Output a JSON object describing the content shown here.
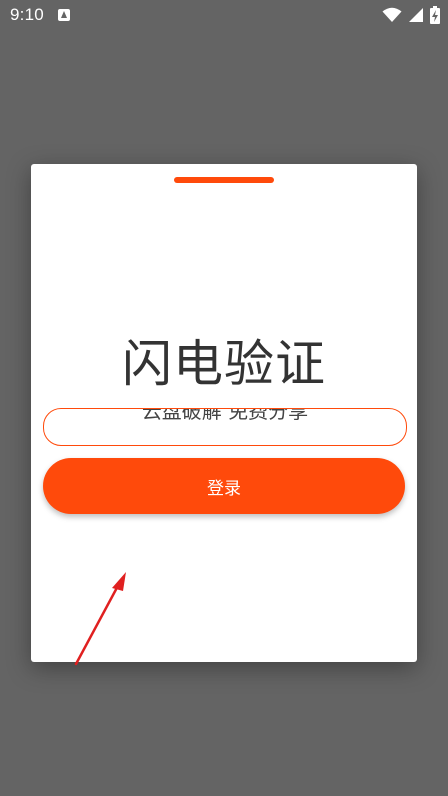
{
  "status_bar": {
    "time": "9:10",
    "icons": [
      "app-notification-icon",
      "wifi-icon",
      "signal-icon",
      "battery-charging-icon"
    ]
  },
  "dialog": {
    "title": "闪电验证",
    "input_value": "云盘破解 免费分享",
    "login_label": "登录"
  },
  "colors": {
    "accent": "#ff4a0b",
    "backdrop": "#646464",
    "annotation_arrow": "#e02020"
  }
}
